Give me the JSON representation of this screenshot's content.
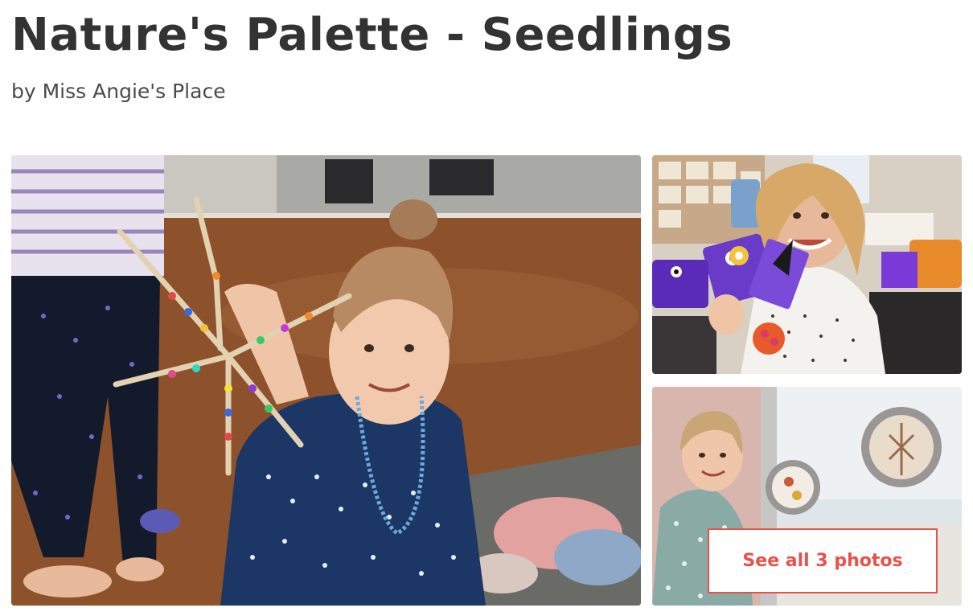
{
  "listing": {
    "title": "Nature's Palette - Seedlings",
    "byline": "by Miss Angie's Place"
  },
  "gallery": {
    "see_all_label": "See all 3 photos",
    "photos": [
      {
        "name": "photo-girl-beaded-pipe-cleaner"
      },
      {
        "name": "photo-girl-felt-puppets"
      },
      {
        "name": "photo-girl-window-suncatchers"
      }
    ]
  },
  "colors": {
    "title_text": "#333333",
    "accent": "#e9524a"
  }
}
